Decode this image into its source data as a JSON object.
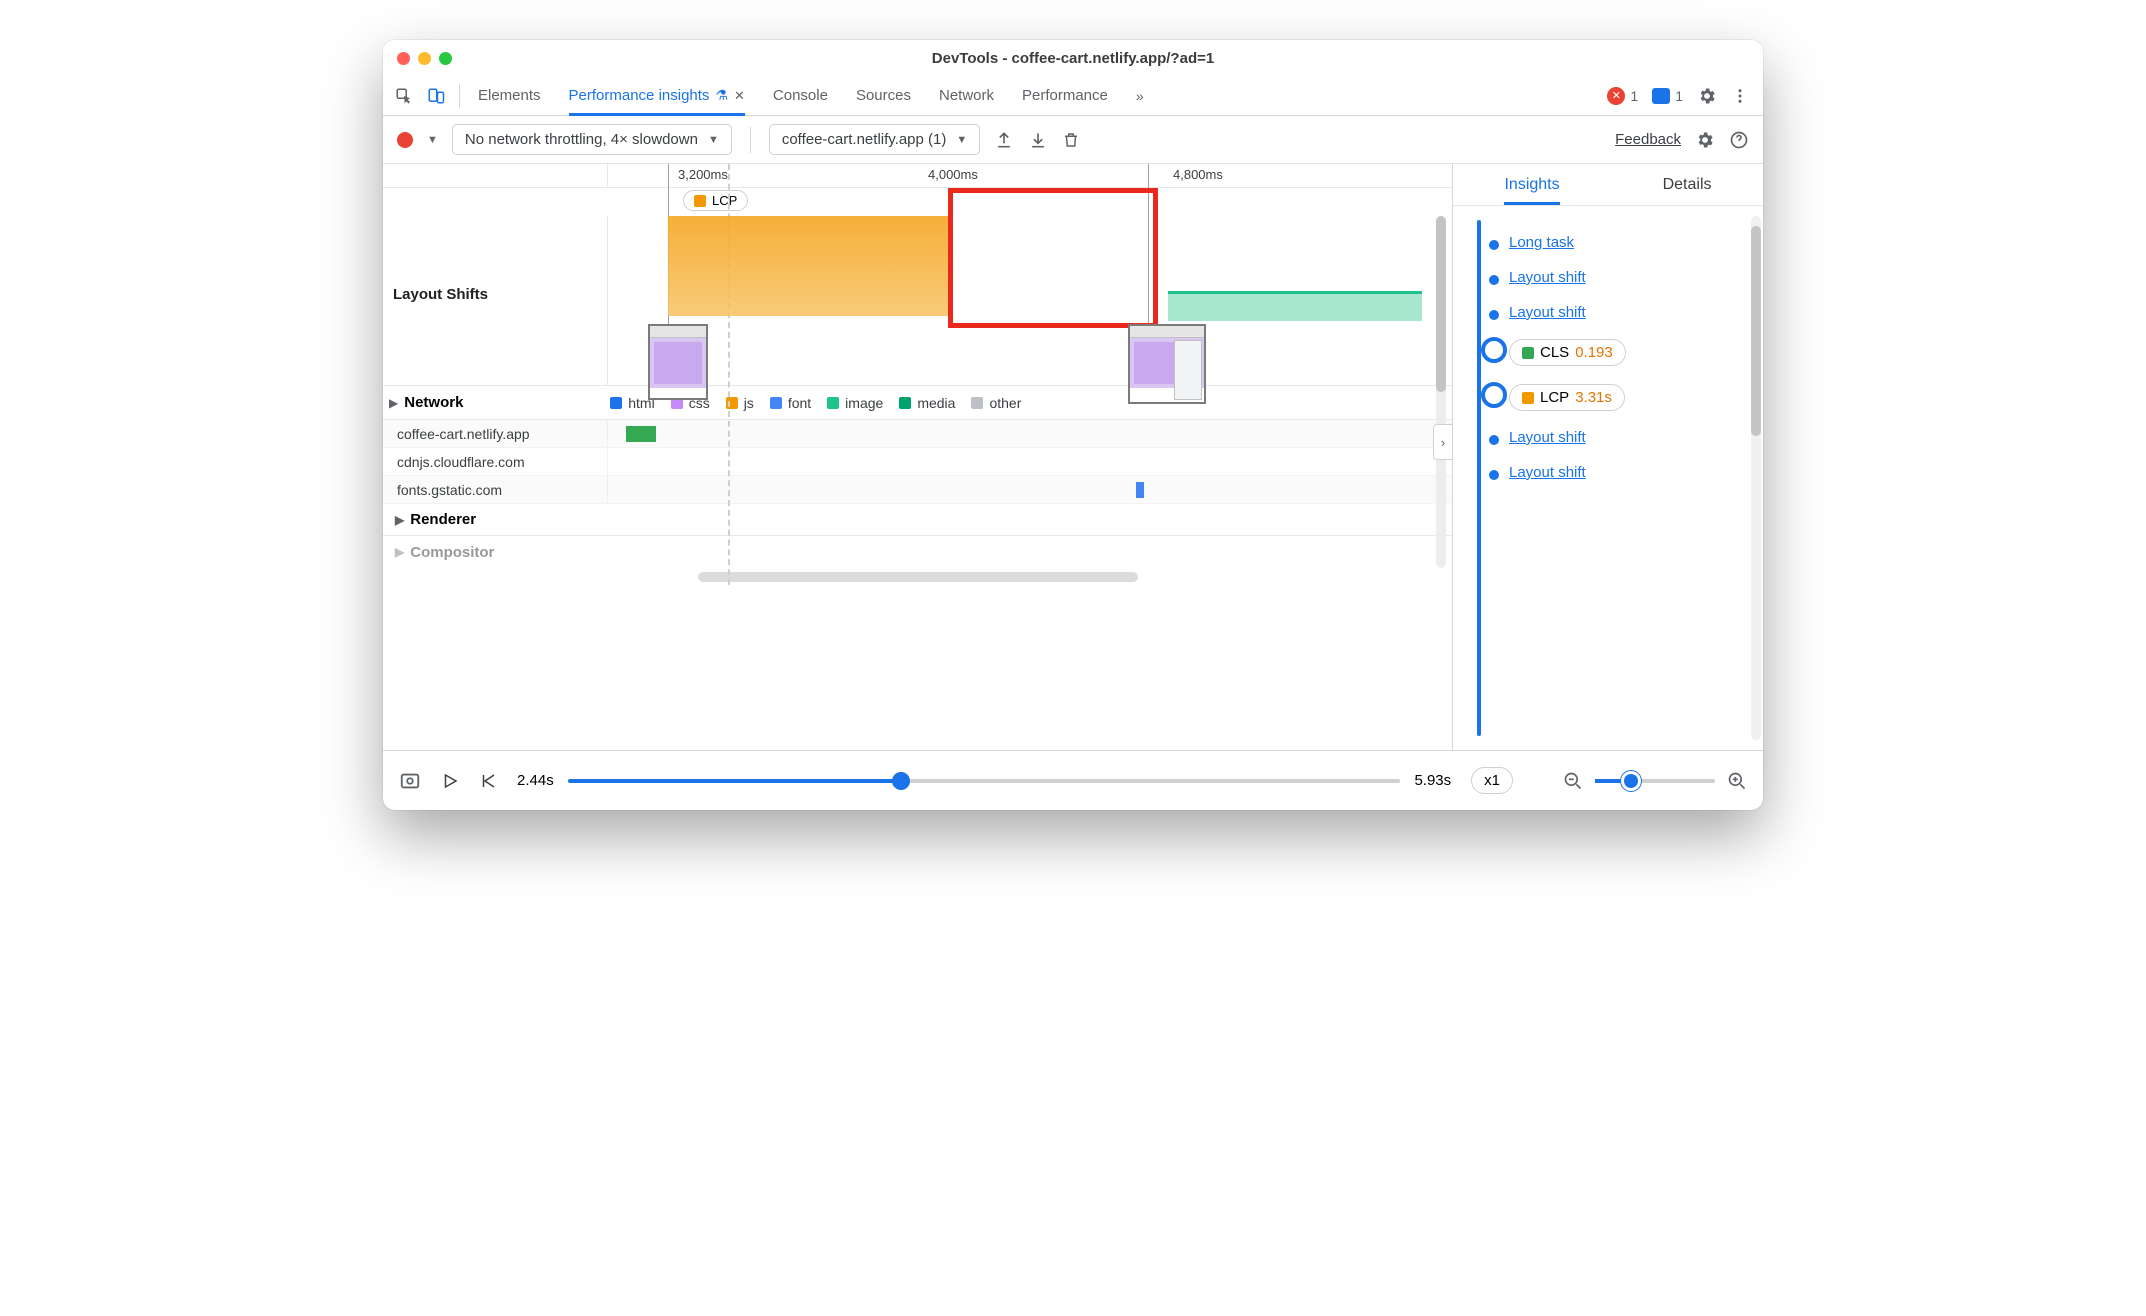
{
  "window": {
    "title": "DevTools - coffee-cart.netlify.app/?ad=1"
  },
  "tabs": {
    "elements": "Elements",
    "perf_insights": "Performance insights",
    "console": "Console",
    "sources": "Sources",
    "network": "Network",
    "performance": "Performance"
  },
  "status": {
    "error_count": "1",
    "message_count": "1"
  },
  "toolbar": {
    "throttling": "No network throttling, 4× slowdown",
    "page_select": "coffee-cart.netlify.app (1)",
    "feedback": "Feedback"
  },
  "ruler": {
    "t1": "3,200ms",
    "t2": "4,000ms",
    "t3": "4,800ms"
  },
  "lcp_chip": "LCP",
  "rows": {
    "layout_shifts": "Layout Shifts",
    "network": "Network",
    "renderer": "Renderer",
    "compositor": "Compositor"
  },
  "legend": {
    "html": "html",
    "css": "css",
    "js": "js",
    "font": "font",
    "image": "image",
    "media": "media",
    "other": "other"
  },
  "hosts": {
    "h1": "coffee-cart.netlify.app",
    "h2": "cdnjs.cloudflare.com",
    "h3": "fonts.gstatic.com"
  },
  "right": {
    "tab_insights": "Insights",
    "tab_details": "Details",
    "items": {
      "long_task": "Long task",
      "layout_shift": "Layout shift",
      "cls_label": "CLS",
      "cls_value": "0.193",
      "lcp_label": "LCP",
      "lcp_value": "3.31s"
    }
  },
  "player": {
    "start": "2.44s",
    "end": "5.93s",
    "speed": "x1"
  }
}
